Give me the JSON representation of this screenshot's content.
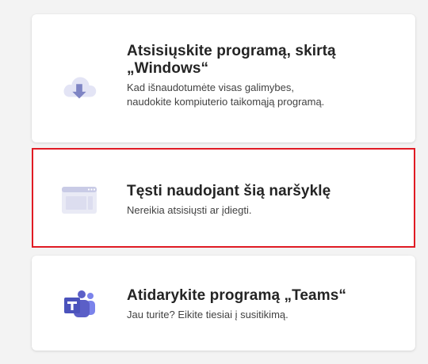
{
  "cards": [
    {
      "title_line1": "Atsisiųskite programą, skirtą",
      "title_line2": "„Windows“",
      "desc_line1": "Kad išnaudotumėte visas galimybes,",
      "desc_line2": "naudokite kompiuterio taikomąją programą.",
      "icon": "cloud-download-icon"
    },
    {
      "title": "Tęsti naudojant šią naršyklę",
      "desc": "Nereikia atsisiųsti ar įdiegti.",
      "icon": "browser-window-icon"
    },
    {
      "title": "Atidarykite programą „Teams“",
      "desc": "Jau turite? Eikite tiesiai į susitikimą.",
      "icon": "teams-logo-icon"
    }
  ],
  "colors": {
    "highlight_border": "#e01b24",
    "icon_purple": "#7f85c4",
    "teams_purple": "#5b5fc7"
  }
}
